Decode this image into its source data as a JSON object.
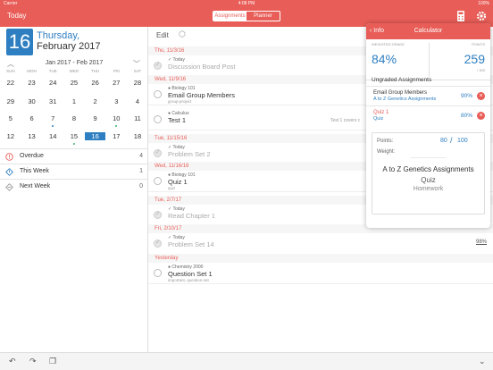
{
  "status_bar": {
    "carrier": "Carrier",
    "time": "4:08 PM",
    "battery": "100%"
  },
  "nav": {
    "today_label": "Today",
    "segments": [
      "Assignments",
      "Planner"
    ],
    "active_segment": "Assignments",
    "right_icons": [
      "calculator-icon",
      "gear-icon"
    ]
  },
  "calendar": {
    "day_number": "16",
    "day_name": "Thursday,",
    "month_year": "February 2017",
    "range_label": "Jan 2017 - Feb 2017",
    "weekdays": [
      "SUN",
      "MON",
      "TUE",
      "WED",
      "THU",
      "FRI",
      "SAT"
    ],
    "weeks": [
      [
        "22",
        "23",
        "24",
        "25",
        "26",
        "27",
        "28"
      ],
      [
        "29",
        "30",
        "31",
        "1",
        "2",
        "3",
        "4"
      ],
      [
        "5",
        "6",
        "7",
        "8",
        "9",
        "10",
        "11"
      ],
      [
        "12",
        "13",
        "14",
        "15",
        "16",
        "17",
        "18"
      ]
    ],
    "selected_day": "16"
  },
  "filters": [
    {
      "label": "Overdue",
      "count": "4",
      "icon": "alert-circle-icon"
    },
    {
      "label": "This Week",
      "count": "1",
      "icon": "diamond-icon"
    },
    {
      "label": "Next Week",
      "count": "0",
      "icon": "minus-circle-icon"
    }
  ],
  "list": {
    "edit_label": "Edit",
    "groups": [
      {
        "date": "Thu, 11/3/16",
        "tasks": [
          {
            "course": "✓ Today",
            "title": "Discussion Board Post",
            "done": true
          }
        ]
      },
      {
        "date": "Wed, 11/9/16",
        "tasks": [
          {
            "course": "● Biology 101",
            "title": "Email Group Members",
            "sub": "group-project",
            "done": false
          },
          {
            "course": "● Calculus",
            "title": "Test 1",
            "note": "Test 1 covers c",
            "done": false
          }
        ]
      },
      {
        "date": "Tue, 11/15/16",
        "tasks": [
          {
            "course": "✓ Today",
            "title": "Problem Set 2",
            "done": true
          }
        ]
      },
      {
        "date": "Wed, 11/16/16",
        "tasks": [
          {
            "course": "● Biology 101",
            "title": "Quiz 1",
            "sub": "quiz",
            "done": false
          }
        ]
      },
      {
        "date": "Tue, 2/7/17",
        "tasks": [
          {
            "course": "✓ Today",
            "title": "Read Chapter 1",
            "done": true
          }
        ]
      },
      {
        "date": "Fri, 2/10/17",
        "tasks": [
          {
            "course": "✓ Today",
            "title": "Problem Set 14",
            "done": true
          }
        ]
      },
      {
        "date": "Yesterday",
        "tasks": [
          {
            "course": "● Chemistry 2000",
            "title": "Question Set 1",
            "sub": "important, question-set",
            "done": false
          }
        ]
      }
    ],
    "side_percent": "98%"
  },
  "calculator": {
    "back_label": "Info",
    "title": "Calculator",
    "weighted_grade_label": "WEIGHTED GRADE",
    "weighted_grade": "84%",
    "points_label": "POINTS",
    "points": "259",
    "points_total": "/ 300",
    "ungraded_title": "Ungraded Assignments",
    "ungraded": [
      {
        "name": "Email Group Members",
        "category": "A to Z Genetics Assignments",
        "percent": "90%"
      },
      {
        "name": "Quiz 1",
        "category": "Quiz",
        "percent": "80%"
      }
    ],
    "editor": {
      "points_label": "Points:",
      "weight_label": "Weight:",
      "points_value": "80",
      "points_out_of": "100",
      "picker_selected": "A to Z Genetics Assignments",
      "picker_next": "Quiz",
      "picker_after": "Homework"
    }
  },
  "colors": {
    "accent": "#e85d57",
    "blue": "#2e7fc1",
    "green": "#3bb26a"
  }
}
